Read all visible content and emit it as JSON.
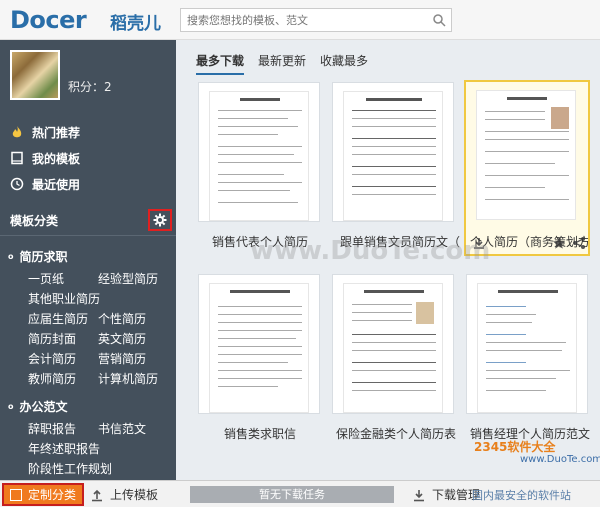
{
  "header": {
    "logo_text": "Docer",
    "logo_cn": "稻壳儿",
    "search_placeholder": "搜索您想找的模板、范文"
  },
  "sidebar": {
    "points_label": "积分：2",
    "nav": [
      {
        "label": "热门推荐",
        "icon": "fire-icon"
      },
      {
        "label": "我的模板",
        "icon": "book-icon"
      },
      {
        "label": "最近使用",
        "icon": "clock-icon"
      }
    ],
    "section_title": "模板分类",
    "groups": [
      {
        "title": "简历求职",
        "links": [
          "一页纸",
          "经验型简历",
          "其他职业简历",
          "应届生简历",
          "个性简历",
          "简历封面",
          "英文简历",
          "会计简历",
          "营销简历",
          "教师简历",
          "计算机简历"
        ]
      },
      {
        "title": "办公范文",
        "links": [
          "辞职报告",
          "书信范文",
          "年终述职报告",
          "阶段性工作规划"
        ]
      }
    ]
  },
  "main": {
    "tabs": [
      "最多下载",
      "最新更新",
      "收藏最多"
    ],
    "active_tab": 0,
    "cards": [
      {
        "label": "销售代表个人简历"
      },
      {
        "label": "跟单销售文员简历文（"
      },
      {
        "label": "个人简历（商务策划方"
      },
      {
        "label": "销售类求职信"
      },
      {
        "label": "保险金融类个人简历表"
      },
      {
        "label": "销售经理个人简历范文"
      }
    ]
  },
  "footer": {
    "custom_label": "定制分类",
    "upload_label": "上传模板",
    "progress_label": "暂无下载任务",
    "download_label": "下载管理",
    "status_text": "国内最安全的软件站"
  },
  "watermark": {
    "text": "www.DuoTe.com",
    "logo_text": "2345软件大全",
    "logo_sub": "www.DuoTe.com"
  },
  "colors": {
    "sidebar": "#44505c",
    "accent": "#2a6ea8",
    "custom_button": "#f07a1e",
    "highlight_border": "#e02020",
    "selected_card": "#f0c840"
  }
}
